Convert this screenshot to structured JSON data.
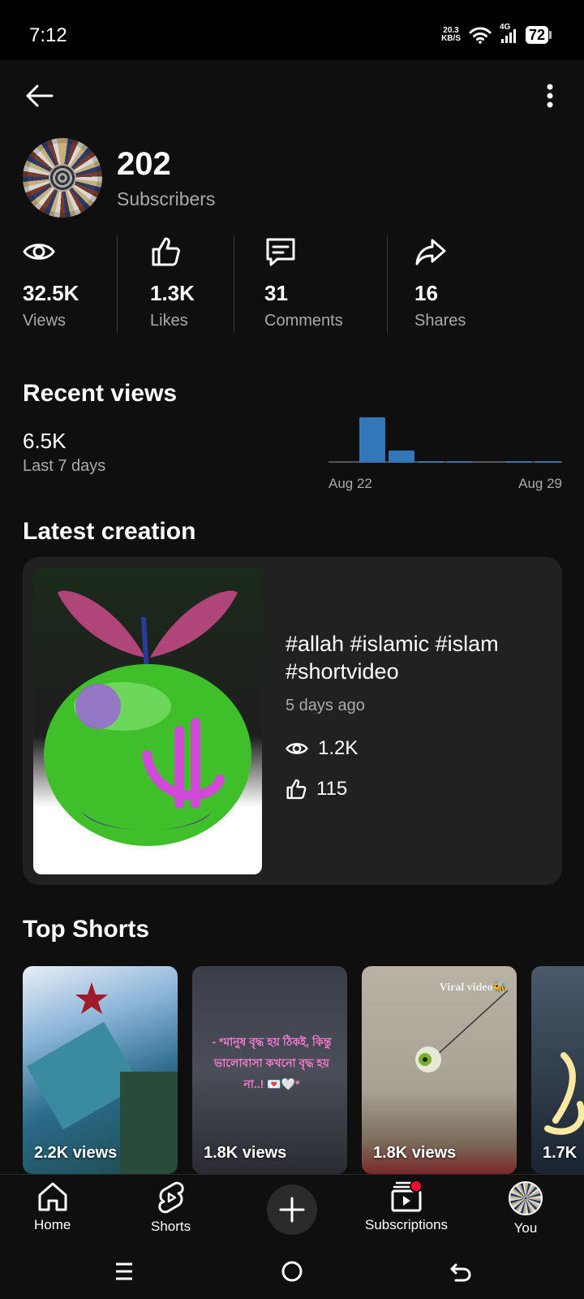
{
  "status_bar": {
    "time": "7:12",
    "net_speed_value": "20.3",
    "net_speed_unit": "KB/S",
    "network_type": "4G",
    "battery": "72"
  },
  "channel": {
    "subscribers_count": "202",
    "subscribers_label": "Subscribers"
  },
  "stats": [
    {
      "icon": "eye-icon",
      "value": "32.5K",
      "label": "Views"
    },
    {
      "icon": "thumbs-up-icon",
      "value": "1.3K",
      "label": "Likes"
    },
    {
      "icon": "comment-icon",
      "value": "31",
      "label": "Comments"
    },
    {
      "icon": "share-icon",
      "value": "16",
      "label": "Shares"
    }
  ],
  "recent_views": {
    "title": "Recent views",
    "value": "6.5K",
    "period": "Last 7 days"
  },
  "chart_data": {
    "type": "bar",
    "categories": [
      "Aug 22",
      "Aug 23",
      "Aug 24",
      "Aug 25",
      "Aug 26",
      "Aug 27",
      "Aug 28",
      "Aug 29"
    ],
    "values": [
      0,
      5200,
      1400,
      60,
      60,
      0,
      60,
      60
    ],
    "first_tick": "Aug 22",
    "last_tick": "Aug 29",
    "bar_color": "#3377bb",
    "baseline_color": "#555555"
  },
  "latest_creation": {
    "title": "Latest creation",
    "video_title": "#allah #islamic #islam #shortvideo",
    "age": "5 days ago",
    "views": "1.2K",
    "likes": "115"
  },
  "top_shorts": {
    "title": "Top Shorts",
    "items": [
      {
        "views": "2.2K views"
      },
      {
        "views": "1.8K views",
        "overlay_text": "- *মানুষ বৃদ্ধ হয় ঠিকই, কিন্তু ভালোবাসা কখনো বৃদ্ধ হয় না..! 💌🤍*"
      },
      {
        "views": "1.8K views",
        "overlay_text": "Viral video🐝"
      },
      {
        "views": "1.7K"
      }
    ]
  },
  "bottom_nav": [
    {
      "label": "Home",
      "icon": "home-icon"
    },
    {
      "label": "Shorts",
      "icon": "shorts-icon"
    },
    {
      "label": "Subscriptions",
      "icon": "subscriptions-icon"
    },
    {
      "label": "You",
      "icon": "avatar"
    }
  ],
  "colors": {
    "background": "#0f0f0f",
    "card": "#212121",
    "secondary_text": "#aaaaaa",
    "notification_dot": "#ff0033"
  }
}
